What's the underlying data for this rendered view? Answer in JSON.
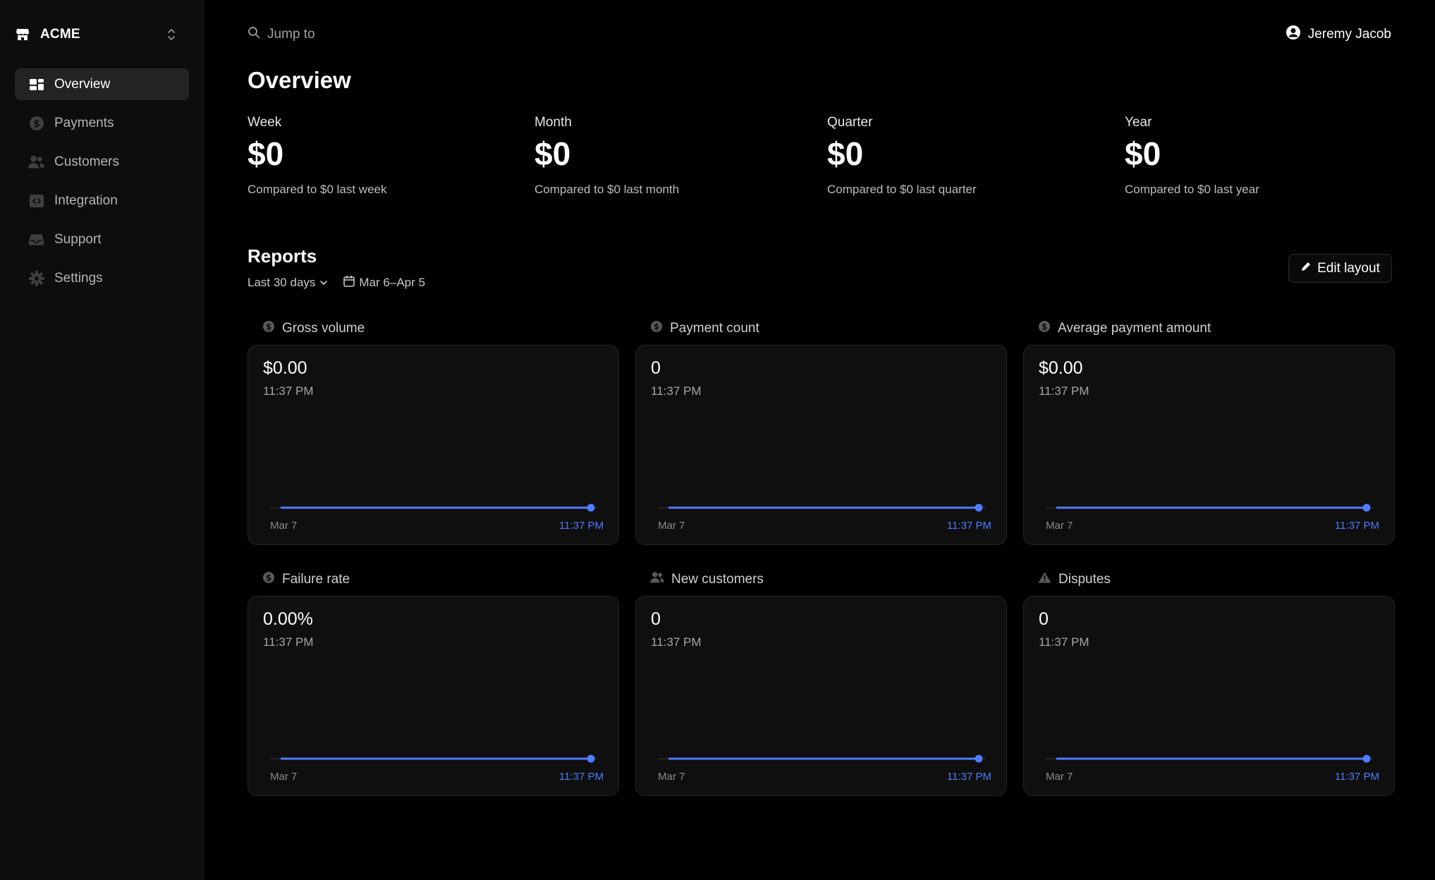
{
  "brand": {
    "name": "ACME"
  },
  "sidebar": {
    "items": [
      {
        "label": "Overview",
        "icon": "overview-icon",
        "active": true
      },
      {
        "label": "Payments",
        "icon": "dollar-circle-icon"
      },
      {
        "label": "Customers",
        "icon": "users-icon"
      },
      {
        "label": "Integration",
        "icon": "code-icon"
      },
      {
        "label": "Support",
        "icon": "inbox-icon"
      },
      {
        "label": "Settings",
        "icon": "gear-icon"
      }
    ]
  },
  "topbar": {
    "search_placeholder": "Jump to",
    "user_name": "Jeremy Jacob"
  },
  "page": {
    "title": "Overview"
  },
  "stats": [
    {
      "label": "Week",
      "value": "$0",
      "compare": "Compared to $0 last week"
    },
    {
      "label": "Month",
      "value": "$0",
      "compare": "Compared to $0 last month"
    },
    {
      "label": "Quarter",
      "value": "$0",
      "compare": "Compared to $0 last quarter"
    },
    {
      "label": "Year",
      "value": "$0",
      "compare": "Compared to $0 last year"
    }
  ],
  "reports": {
    "title": "Reports",
    "range_label": "Last 30 days",
    "date_range": "Mar 6–Apr 5",
    "edit_label": "Edit layout"
  },
  "cards": [
    {
      "title": "Gross volume",
      "icon": "dollar-circle-icon",
      "value": "$0.00",
      "time": "11:37 PM",
      "x_start": "Mar 7",
      "x_end": "11:37 PM"
    },
    {
      "title": "Payment count",
      "icon": "dollar-circle-icon",
      "value": "0",
      "time": "11:37 PM",
      "x_start": "Mar 7",
      "x_end": "11:37 PM"
    },
    {
      "title": "Average payment amount",
      "icon": "dollar-circle-icon",
      "value": "$0.00",
      "time": "11:37 PM",
      "x_start": "Mar 7",
      "x_end": "11:37 PM"
    },
    {
      "title": "Failure rate",
      "icon": "dollar-circle-icon",
      "value": "0.00%",
      "time": "11:37 PM",
      "x_start": "Mar 7",
      "x_end": "11:37 PM"
    },
    {
      "title": "New customers",
      "icon": "users-icon",
      "value": "0",
      "time": "11:37 PM",
      "x_start": "Mar 7",
      "x_end": "11:37 PM"
    },
    {
      "title": "Disputes",
      "icon": "warning-icon",
      "value": "0",
      "time": "11:37 PM",
      "x_start": "Mar 7",
      "x_end": "11:37 PM"
    }
  ],
  "colors": {
    "accent": "#4f7bff",
    "background": "#000000",
    "sidebar": "#0d0d0d",
    "card": "#0f0f0f"
  }
}
